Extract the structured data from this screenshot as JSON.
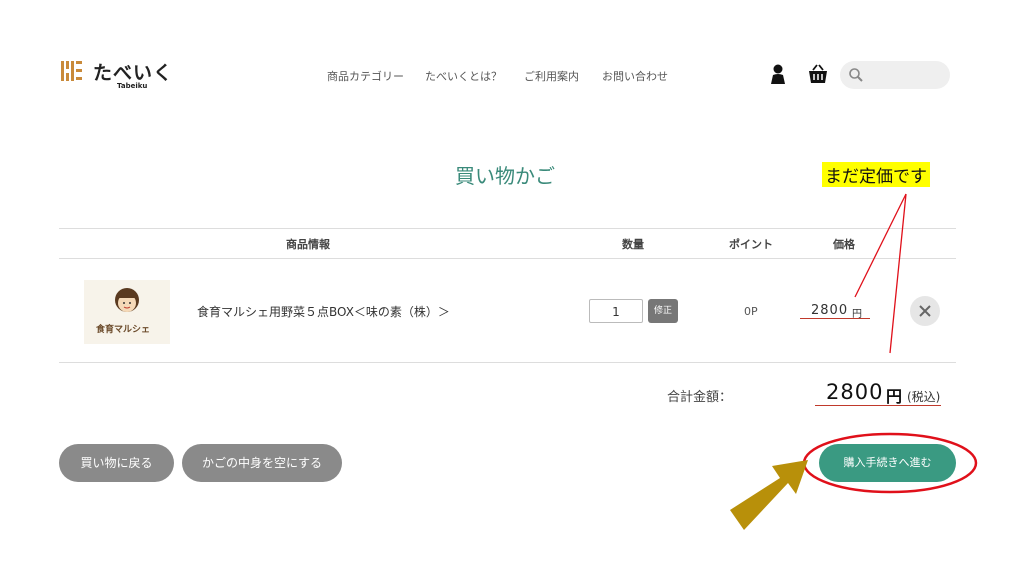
{
  "header": {
    "logo_text": "たべいく",
    "logo_sub": "Tabeiku",
    "nav": [
      "商品カテゴリー",
      "たべいくとは？",
      "ご利用案内",
      "お問い合わせ"
    ],
    "icons": [
      "user-icon",
      "cart-icon",
      "search-icon"
    ]
  },
  "page": {
    "title": "買い物かご",
    "annotation_note": "まだ定価です"
  },
  "table": {
    "headers": {
      "product": "商品情報",
      "quantity": "数量",
      "point": "ポイント",
      "price": "価格"
    },
    "rows": [
      {
        "image_label": "食育マルシェ",
        "name": "食育マルシェ用野菜５点BOX＜味の素（株）＞",
        "quantity": "1",
        "update_label": "修正",
        "point": "0P",
        "price": "2800",
        "price_unit": "円"
      }
    ]
  },
  "total": {
    "label": "合計金額：",
    "value": "2800",
    "unit": "円",
    "tax_note": "(税込)"
  },
  "buttons": {
    "back": "買い物に戻る",
    "empty": "かごの中身を空にする",
    "checkout": "購入手続きへ進む"
  },
  "colors": {
    "accent_green": "#3a9a82",
    "title_green": "#3a8a7a",
    "annotation_red": "#e0101a",
    "arrow_gold": "#b8900a",
    "highlight_yellow": "#ffff00"
  }
}
